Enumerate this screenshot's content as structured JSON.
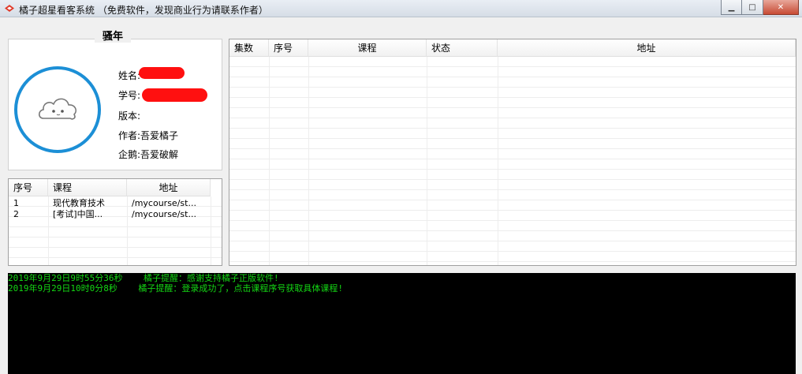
{
  "window": {
    "title": "橘子超星看客系统 （免费软件，发现商业行为请联系作者）"
  },
  "user": {
    "display_name": "骚年",
    "fields": [
      {
        "label": "姓名:",
        "value": ""
      },
      {
        "label": "学号:",
        "value": ""
      },
      {
        "label": "版本:",
        "value": ""
      },
      {
        "label": "作者:",
        "value": "吾爱橘子"
      },
      {
        "label": "企鹅:",
        "value": "吾爱破解"
      }
    ]
  },
  "course_table": {
    "columns": [
      "序号",
      "课程",
      "地址"
    ],
    "rows": [
      {
        "index": "1",
        "course": "现代教育技术",
        "address": "/mycourse/st..."
      },
      {
        "index": "2",
        "course": "[考试]中国...",
        "address": "/mycourse/st..."
      }
    ]
  },
  "chapter_table": {
    "columns": [
      "集数",
      "序号",
      "课程",
      "状态",
      "地址"
    ],
    "rows": []
  },
  "log": {
    "lines": [
      {
        "time": "2019年9月29日9时55分36秒",
        "message": "橘子提醒：感谢支持橘子正版软件!"
      },
      {
        "time": "2019年9月29日10时0分8秒",
        "message": "橘子提醒：登录成功了，点击课程序号获取具体课程!"
      }
    ]
  },
  "colors": {
    "avatar_ring": "#1c8fd6",
    "log_text": "#14d614",
    "log_bg": "#000000",
    "redaction": "#ff1010"
  }
}
